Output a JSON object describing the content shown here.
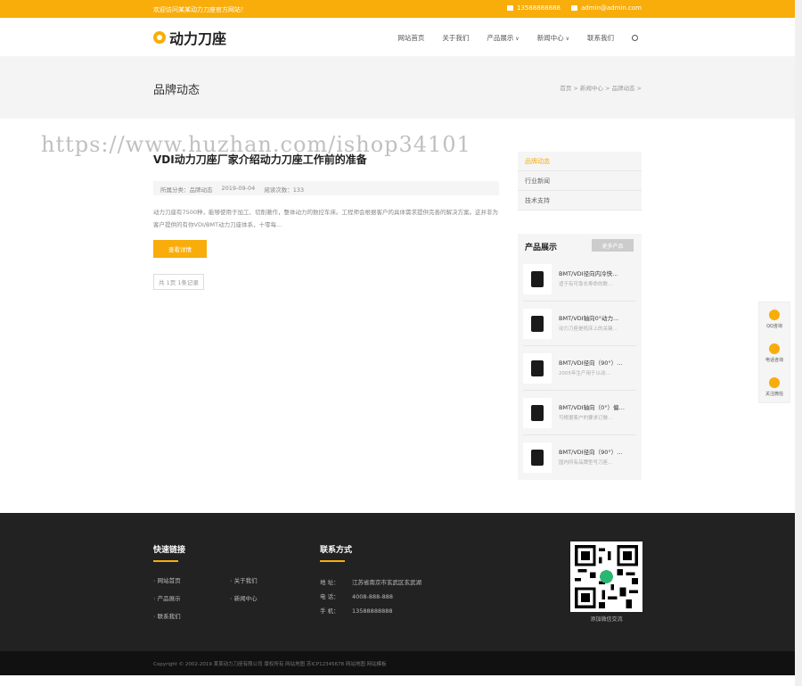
{
  "topbar": {
    "welcome": "欢迎访问某某动力刀座官方网站！",
    "phone": "13588888888",
    "email": "admin@admin.com"
  },
  "header": {
    "logo_text": "动力刀座",
    "nav": [
      "网站首页",
      "关于我们",
      "产品展示",
      "新闻中心",
      "联系我们"
    ]
  },
  "banner": {
    "title": "品牌动态",
    "breadcrumb": "首页 > 新闻中心 > 品牌动态 >"
  },
  "watermark": "https://www.huzhan.com/ishop34101",
  "article": {
    "title": "VDI动力刀座厂家介绍动力刀座工作前的准备",
    "category": "所属分类：品牌动态",
    "date": "2019-09-04",
    "views": "阅读次数：133",
    "summary": "动力刀座有7500种，能够使用于加工、切削著作，整体动力的数控车床。工程师会根据客户的具体需求提供完善的解决方案。这并非为客户提供的有你VDI/BMT动力刀座体系，十零每...",
    "read_more": "查看详情",
    "pager": "共 1页 1条记录"
  },
  "sidebar": {
    "categories": [
      "品牌动态",
      "行业新闻",
      "技术支持"
    ],
    "products_title": "产品展示",
    "products_more": "更多产品",
    "products": [
      {
        "name": "BMT/VDI径向内冷快…",
        "desc": "适于有可靠长寿命的数…"
      },
      {
        "name": "BMT/VDI轴向0°动力…",
        "desc": "动力刀座是机床上的关键…"
      },
      {
        "name": "BMT/VDI径向（90°）…",
        "desc": "2005年生产用于以动…"
      },
      {
        "name": "BMT/VDI轴向（0°）偏…",
        "desc": "可根据客户的要求订做…"
      },
      {
        "name": "BMT/VDI径向（90°）…",
        "desc": "国内所有品牌型号刀座…"
      }
    ]
  },
  "float_bar": [
    "QQ咨询",
    "电话咨询",
    "关注微信"
  ],
  "footer": {
    "links_title": "快速链接",
    "links": [
      "网站首页",
      "关于我们",
      "产品展示",
      "新闻中心",
      "联系我们"
    ],
    "contact_title": "联系方式",
    "contact": [
      {
        "label": "地 址：",
        "value": "江苏省南京市玄武区玄武湖"
      },
      {
        "label": "电 话：",
        "value": "4008-888-888"
      },
      {
        "label": "手 机：",
        "value": "13588888888"
      }
    ],
    "qr_caption": "添加微信交流",
    "copyright": "Copyright © 2002-2019 某某动力刀座有限公司 版权所有    网站地图    苏ICP12345678    网站地图    网站模板"
  },
  "colors": {
    "accent": "#f8ad0b",
    "footer_bg": "#222222"
  }
}
